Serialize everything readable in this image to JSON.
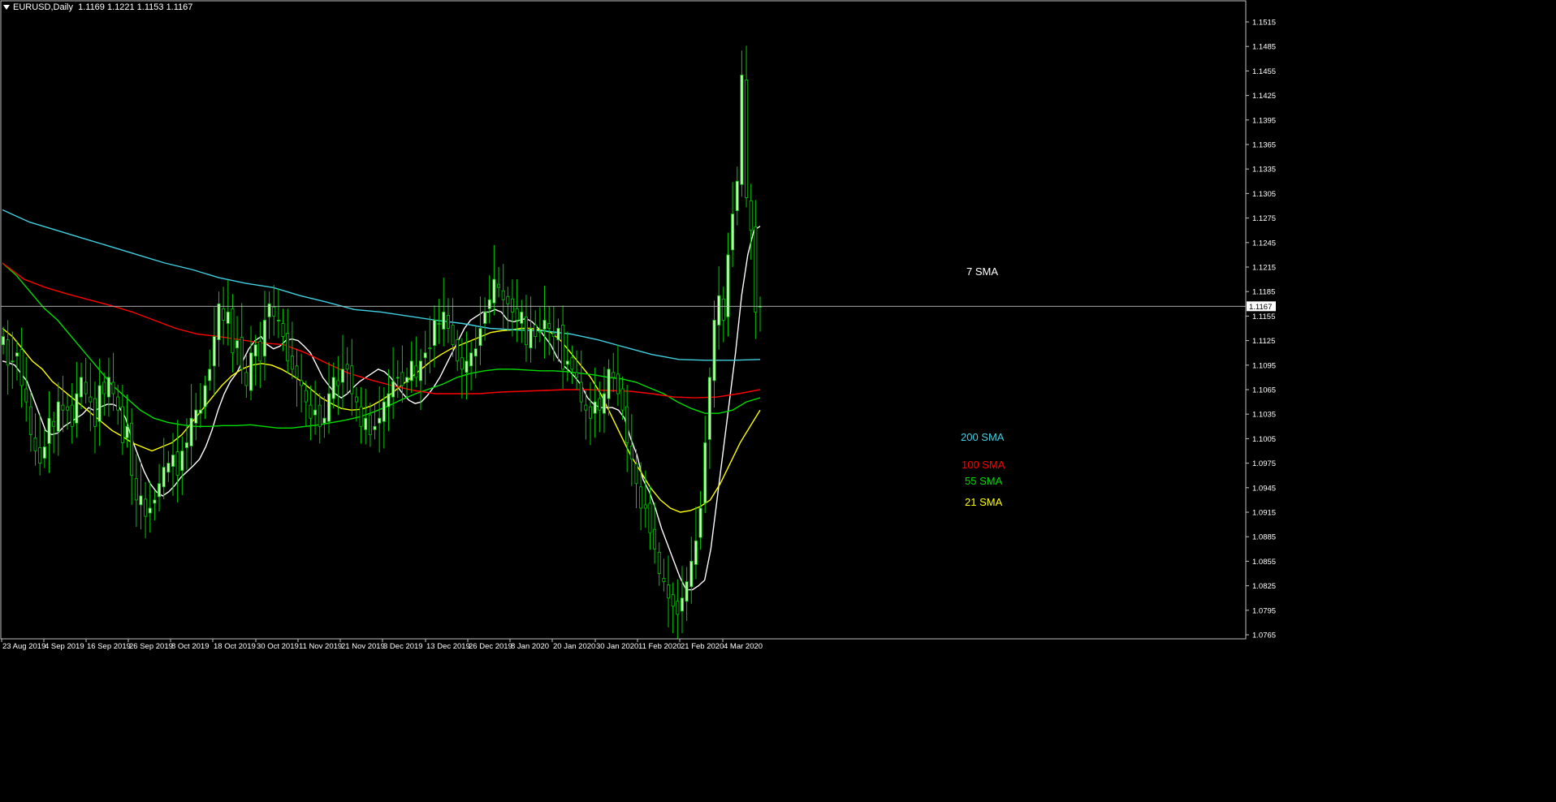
{
  "header": {
    "symbol": "EURUSD,Daily",
    "ohlc": "1.1169 1.1221 1.1153 1.1167"
  },
  "chart_data": {
    "type": "candlestick",
    "symbol": "EURUSD",
    "timeframe": "Daily",
    "ylim": [
      1.0765,
      1.1525
    ],
    "y_ticks": [
      "1.1515",
      "1.1485",
      "1.1455",
      "1.1425",
      "1.1395",
      "1.1365",
      "1.1335",
      "1.1305",
      "1.1275",
      "1.1245",
      "1.1215",
      "1.1185",
      "1.1155",
      "1.1125",
      "1.1095",
      "1.1065",
      "1.1035",
      "1.1005",
      "1.0975",
      "1.0945",
      "1.0915",
      "1.0885",
      "1.0855",
      "1.0825",
      "1.0795",
      "1.0765"
    ],
    "x_ticks": [
      "23 Aug 2019",
      "4 Sep 2019",
      "16 Sep 2019",
      "26 Sep 2019",
      "8 Oct 2019",
      "18 Oct 2019",
      "30 Oct 2019",
      "11 Nov 2019",
      "21 Nov 2019",
      "3 Dec 2019",
      "13 Dec 2019",
      "26 Dec 2019",
      "8 Jan 2020",
      "20 Jan 2020",
      "30 Jan 2020",
      "11 Feb 2020",
      "21 Feb 2020",
      "4 Mar 2020"
    ],
    "current_price": "1.1167",
    "grid": false,
    "colors": {
      "background": "#000000",
      "candle": "#00c800",
      "bull_body": "#c8ffb8",
      "axis": "#c0c0c0",
      "price_line": "#c0c0c0"
    },
    "close": [
      1.113,
      1.1095,
      1.11,
      1.111,
      1.107,
      1.105,
      1.101,
      1.099,
      1.0975,
      1.0995,
      1.103,
      1.102,
      1.105,
      1.104,
      1.104,
      1.102,
      1.106,
      1.108,
      1.106,
      1.105,
      1.102,
      1.107,
      1.106,
      1.108,
      1.106,
      1.104,
      1.1,
      1.102,
      1.096,
      1.093,
      1.0935,
      1.091,
      1.092,
      1.093,
      1.095,
      1.097,
      1.0975,
      1.0985,
      1.096,
      1.099,
      1.1,
      1.103,
      1.104,
      1.104,
      1.107,
      1.109,
      1.113,
      1.117,
      1.115,
      1.116,
      1.111,
      1.1125,
      1.109,
      1.107,
      1.111,
      1.112,
      1.11,
      1.115,
      1.117,
      1.1155,
      1.115,
      1.113,
      1.11,
      1.109,
      1.108,
      1.107,
      1.105,
      1.103,
      1.104,
      1.102,
      1.103,
      1.106,
      1.108,
      1.107,
      1.109,
      1.109,
      1.106,
      1.105,
      1.102,
      1.103,
      1.101,
      1.102,
      1.103,
      1.105,
      1.106,
      1.1075,
      1.108,
      1.107,
      1.108,
      1.11,
      1.108,
      1.11,
      1.111,
      1.1115,
      1.115,
      1.1145,
      1.116,
      1.114,
      1.112,
      1.11,
      1.109,
      1.11,
      1.111,
      1.1115,
      1.114,
      1.116,
      1.1175,
      1.12,
      1.119,
      1.1175,
      1.117,
      1.116,
      1.115,
      1.116,
      1.112,
      1.114,
      1.113,
      1.1135,
      1.115,
      1.114,
      1.113,
      1.114,
      1.109,
      1.11,
      1.109,
      1.108,
      1.105,
      1.104,
      1.103,
      1.105,
      1.104,
      1.106,
      1.109,
      1.108,
      1.106,
      1.104,
      1.1,
      1.098,
      1.095,
      1.092,
      1.092,
      1.089,
      1.087,
      1.084,
      1.083,
      1.081,
      1.08,
      1.079,
      1.081,
      1.083,
      1.0855,
      1.088,
      1.092,
      1.1,
      1.108,
      1.115,
      1.118,
      1.115,
      1.123,
      1.128,
      1.132,
      1.145,
      1.13,
      1.126,
      1.116,
      1.1167
    ],
    "series": [
      {
        "name": "7 SMA",
        "color": "#ffffff",
        "values": [
          1.11,
          1.1098,
          1.1095,
          1.1085,
          1.1075,
          1.1055,
          1.1035,
          1.1015,
          1.101,
          1.1012,
          1.102,
          1.1025,
          1.103,
          1.1035,
          1.1043,
          1.1039,
          1.1044,
          1.1047,
          1.1047,
          1.1043,
          1.103,
          1.1005,
          1.0985,
          1.0965,
          1.095,
          1.094,
          1.0935,
          1.094,
          1.0948,
          1.0958,
          1.0965,
          1.0972,
          1.098,
          1.0995,
          1.1015,
          1.104,
          1.106,
          1.1075,
          1.1085,
          1.11,
          1.1115,
          1.1125,
          1.113,
          1.112,
          1.1115,
          1.1118,
          1.1125,
          1.1127,
          1.1125,
          1.1118,
          1.111,
          1.1095,
          1.108,
          1.107,
          1.106,
          1.1055,
          1.106,
          1.1068,
          1.1075,
          1.108,
          1.1085,
          1.109,
          1.1087,
          1.108,
          1.107,
          1.106,
          1.1052,
          1.1048,
          1.105,
          1.1058,
          1.1068,
          1.108,
          1.1095,
          1.111,
          1.1125,
          1.114,
          1.115,
          1.1155,
          1.116,
          1.116,
          1.1163,
          1.116,
          1.115,
          1.1148,
          1.115,
          1.1152,
          1.1148,
          1.114,
          1.113,
          1.112,
          1.1105,
          1.1095,
          1.1088,
          1.108,
          1.107,
          1.1055,
          1.1047,
          1.1043,
          1.1043,
          1.1043,
          1.104,
          1.103,
          1.1005,
          1.0985,
          1.0955,
          1.094,
          1.092,
          1.0895,
          1.0875,
          1.0855,
          1.0835,
          1.082,
          1.082,
          1.0825,
          1.0832,
          1.087,
          1.093,
          1.099,
          1.105,
          1.111,
          1.118,
          1.123,
          1.126,
          1.1265
        ]
      },
      {
        "name": "21 SMA",
        "color": "#ffff00",
        "values": [
          1.114,
          1.113,
          1.1115,
          1.11,
          1.109,
          1.1075,
          1.1065,
          1.1055,
          1.1045,
          1.1035,
          1.1025,
          1.1015,
          1.1008,
          1.1,
          1.0995,
          1.099,
          1.0995,
          1.1,
          1.101,
          1.1025,
          1.104,
          1.1055,
          1.107,
          1.1082,
          1.109,
          1.1095,
          1.1097,
          1.1095,
          1.109,
          1.1083,
          1.1075,
          1.1065,
          1.1055,
          1.1048,
          1.1042,
          1.104,
          1.1041,
          1.1045,
          1.1052,
          1.106,
          1.107,
          1.108,
          1.109,
          1.11,
          1.1108,
          1.1115,
          1.112,
          1.1125,
          1.113,
          1.1135,
          1.1137,
          1.1138,
          1.114,
          1.114,
          1.1138,
          1.1135,
          1.1125,
          1.111,
          1.1095,
          1.108,
          1.106,
          1.1035,
          1.101,
          1.0985,
          1.0965,
          1.0945,
          1.093,
          1.092,
          1.0915,
          1.0917,
          1.0922,
          1.093,
          1.095,
          1.0975,
          1.1,
          1.102,
          1.104
        ]
      },
      {
        "name": "55 SMA",
        "color": "#00dd00",
        "values": [
          1.122,
          1.1205,
          1.1185,
          1.1165,
          1.115,
          1.113,
          1.111,
          1.109,
          1.107,
          1.1055,
          1.104,
          1.103,
          1.1025,
          1.1022,
          1.102,
          1.102,
          1.1021,
          1.1021,
          1.1022,
          1.102,
          1.1018,
          1.1018,
          1.102,
          1.1022,
          1.1025,
          1.1028,
          1.1032,
          1.1038,
          1.1045,
          1.1053,
          1.106,
          1.1066,
          1.1072,
          1.108,
          1.1085,
          1.1088,
          1.109,
          1.109,
          1.1089,
          1.1088,
          1.1088,
          1.1087,
          1.1085,
          1.1083,
          1.108,
          1.1078,
          1.1074,
          1.1067,
          1.106,
          1.105,
          1.1042,
          1.1036,
          1.1036,
          1.104,
          1.105,
          1.1055
        ]
      },
      {
        "name": "100 SMA",
        "color": "#ff0000",
        "values": [
          1.122,
          1.12,
          1.119,
          1.1182,
          1.1175,
          1.1168,
          1.116,
          1.115,
          1.114,
          1.1133,
          1.113,
          1.1126,
          1.1122,
          1.112,
          1.111,
          1.1097,
          1.1085,
          1.1077,
          1.107,
          1.1064,
          1.106,
          1.106,
          1.106,
          1.1062,
          1.1063,
          1.1064,
          1.1065,
          1.1065,
          1.1064,
          1.1063,
          1.106,
          1.1056,
          1.1055,
          1.1056,
          1.106,
          1.1065
        ]
      },
      {
        "name": "200 SMA",
        "color": "#40d0e0",
        "values": [
          1.1285,
          1.127,
          1.126,
          1.125,
          1.124,
          1.123,
          1.122,
          1.1212,
          1.1202,
          1.1195,
          1.119,
          1.118,
          1.1172,
          1.1163,
          1.116,
          1.1155,
          1.115,
          1.1146,
          1.114,
          1.1138,
          1.1137,
          1.1133,
          1.1126,
          1.1117,
          1.1108,
          1.1102,
          1.1101,
          1.1101,
          1.1102
        ]
      }
    ]
  }
}
